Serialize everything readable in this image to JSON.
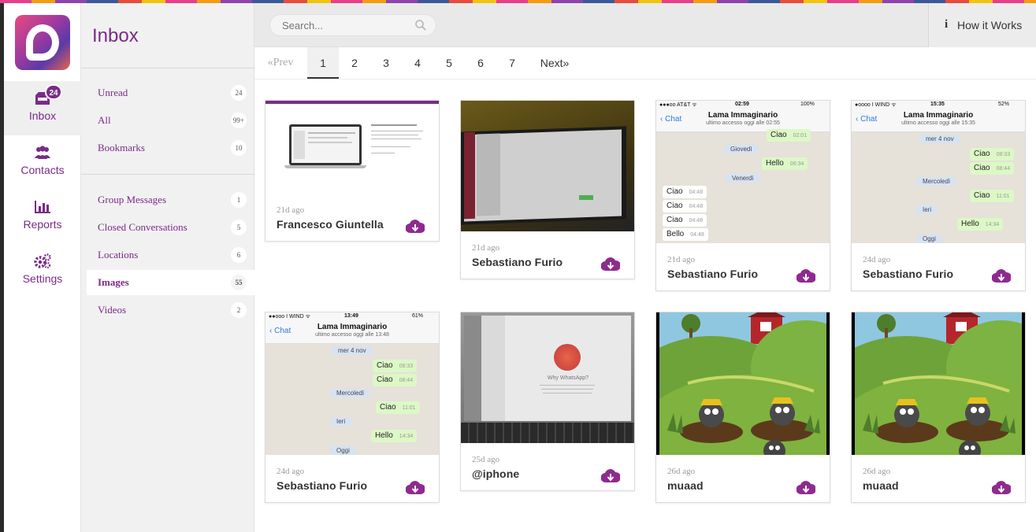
{
  "nav": {
    "items": [
      {
        "label": "Inbox",
        "badge": "24",
        "icon": "inbox-icon"
      },
      {
        "label": "Contacts",
        "icon": "users-icon"
      },
      {
        "label": "Reports",
        "icon": "bar-chart-icon"
      },
      {
        "label": "Settings",
        "icon": "gears-icon"
      }
    ]
  },
  "sidebar": {
    "title": "Inbox",
    "folders": [
      {
        "label": "Unread",
        "count": "24"
      },
      {
        "label": "All",
        "count": "99+"
      },
      {
        "label": "Bookmarks",
        "count": "10"
      },
      {
        "label": "Group Messages",
        "count": "1"
      },
      {
        "label": "Closed Conversations",
        "count": "5"
      },
      {
        "label": "Locations",
        "count": "6"
      },
      {
        "label": "Images",
        "count": "55"
      },
      {
        "label": "Videos",
        "count": "2"
      }
    ]
  },
  "search": {
    "placeholder": "Search..."
  },
  "help": {
    "label": "How it Works",
    "icon_glyph": "i"
  },
  "pager": {
    "prev": "«Prev",
    "pages": [
      "1",
      "2",
      "3",
      "4",
      "5",
      "6",
      "7"
    ],
    "current": "1",
    "next": "Next»"
  },
  "cards": [
    {
      "date": "21d ago",
      "name": "Francesco Giuntella"
    },
    {
      "date": "21d ago",
      "name": "Sebastiano Furio"
    },
    {
      "date": "21d ago",
      "name": "Sebastiano Furio"
    },
    {
      "date": "24d ago",
      "name": "Sebastiano Furio"
    },
    {
      "date": "24d ago",
      "name": "Sebastiano Furio"
    },
    {
      "date": "25d ago",
      "name": "@iphone"
    },
    {
      "date": "26d ago",
      "name": "muaad"
    },
    {
      "date": "26d ago",
      "name": "muaad"
    }
  ],
  "chat3": {
    "status_left": "●●●oo AT&T ᯤ",
    "time": "02:59",
    "battery": "100%",
    "back": "Chat",
    "title": "Lama Immaginario",
    "subtitle": "ultimo accesso oggi alle 02:55",
    "lines": [
      {
        "text": "Ciao",
        "time": "02:01",
        "dir": "out"
      },
      {
        "text": "Giovedì",
        "dir": "day"
      },
      {
        "text": "Hello",
        "time": "06:34",
        "dir": "out"
      },
      {
        "text": "Venerdì",
        "dir": "day"
      },
      {
        "text": "Ciao",
        "time": "04:48",
        "dir": "in"
      },
      {
        "text": "Ciao",
        "time": "04:48",
        "dir": "in"
      },
      {
        "text": "Ciao",
        "time": "04:48",
        "dir": "in"
      },
      {
        "text": "Bello",
        "time": "04:48",
        "dir": "in"
      }
    ]
  },
  "chat4": {
    "status_left": "●oooo I WIND ᯤ",
    "time": "15:35",
    "battery": "52%",
    "back": "Chat",
    "title": "Lama Immaginario",
    "subtitle": "ultimo accesso oggi alle 15:35",
    "lines": [
      {
        "text": "mer 4 nov",
        "dir": "day"
      },
      {
        "text": "Ciao",
        "time": "08:33",
        "dir": "out"
      },
      {
        "text": "Ciao",
        "time": "08:44",
        "dir": "out"
      },
      {
        "text": "Mercoledì",
        "dir": "day"
      },
      {
        "text": "Ciao",
        "time": "11:01",
        "dir": "out"
      },
      {
        "text": "Ieri",
        "dir": "day"
      },
      {
        "text": "Hello",
        "time": "14:34",
        "dir": "out"
      },
      {
        "text": "Oggi",
        "dir": "day"
      }
    ]
  },
  "chat5": {
    "status_left": "●●ooo I WIND ᯤ",
    "time": "13:49",
    "battery": "61%",
    "back": "Chat",
    "title": "Lama Immaginario",
    "subtitle": "ultimo accesso oggi alle 13:48",
    "lines": [
      {
        "text": "mer 4 nov",
        "dir": "day"
      },
      {
        "text": "Ciao",
        "time": "08:33",
        "dir": "out"
      },
      {
        "text": "Ciao",
        "time": "08:44",
        "dir": "out"
      },
      {
        "text": "Mercoledì",
        "dir": "day"
      },
      {
        "text": "Ciao",
        "time": "11:01",
        "dir": "out"
      },
      {
        "text": "Ieri",
        "dir": "day"
      },
      {
        "text": "Hello",
        "time": "14:34",
        "dir": "out"
      },
      {
        "text": "Oggi",
        "dir": "day"
      }
    ]
  },
  "laptop_screen": {
    "title": "Why WhatsApp?"
  },
  "colors": {
    "brand": "#7a2b87",
    "accent_pink": "#e84a7f"
  }
}
